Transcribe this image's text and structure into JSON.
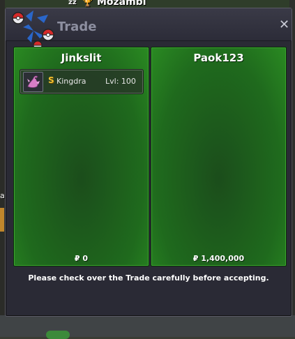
{
  "background": {
    "player_name": "Mozambi"
  },
  "window": {
    "title": "Trade",
    "close_glyph": "✕",
    "message": "Please check over the Trade carefully before accepting."
  },
  "left_panel": {
    "player": "Jinkslit",
    "money": "₽ 0",
    "items": [
      {
        "name": "Kingdra",
        "level": "Lvl: 100",
        "badge": "S",
        "icon": "kingdra-sprite-icon"
      }
    ]
  },
  "right_panel": {
    "player": "Paok123",
    "money": "₽ 1,400,000",
    "items": []
  },
  "colors": {
    "panel_green": "#1f6a1d",
    "window_bg": "#2a2a35",
    "title_text": "#8d8fa0",
    "badge_gold": "#f2c232"
  }
}
